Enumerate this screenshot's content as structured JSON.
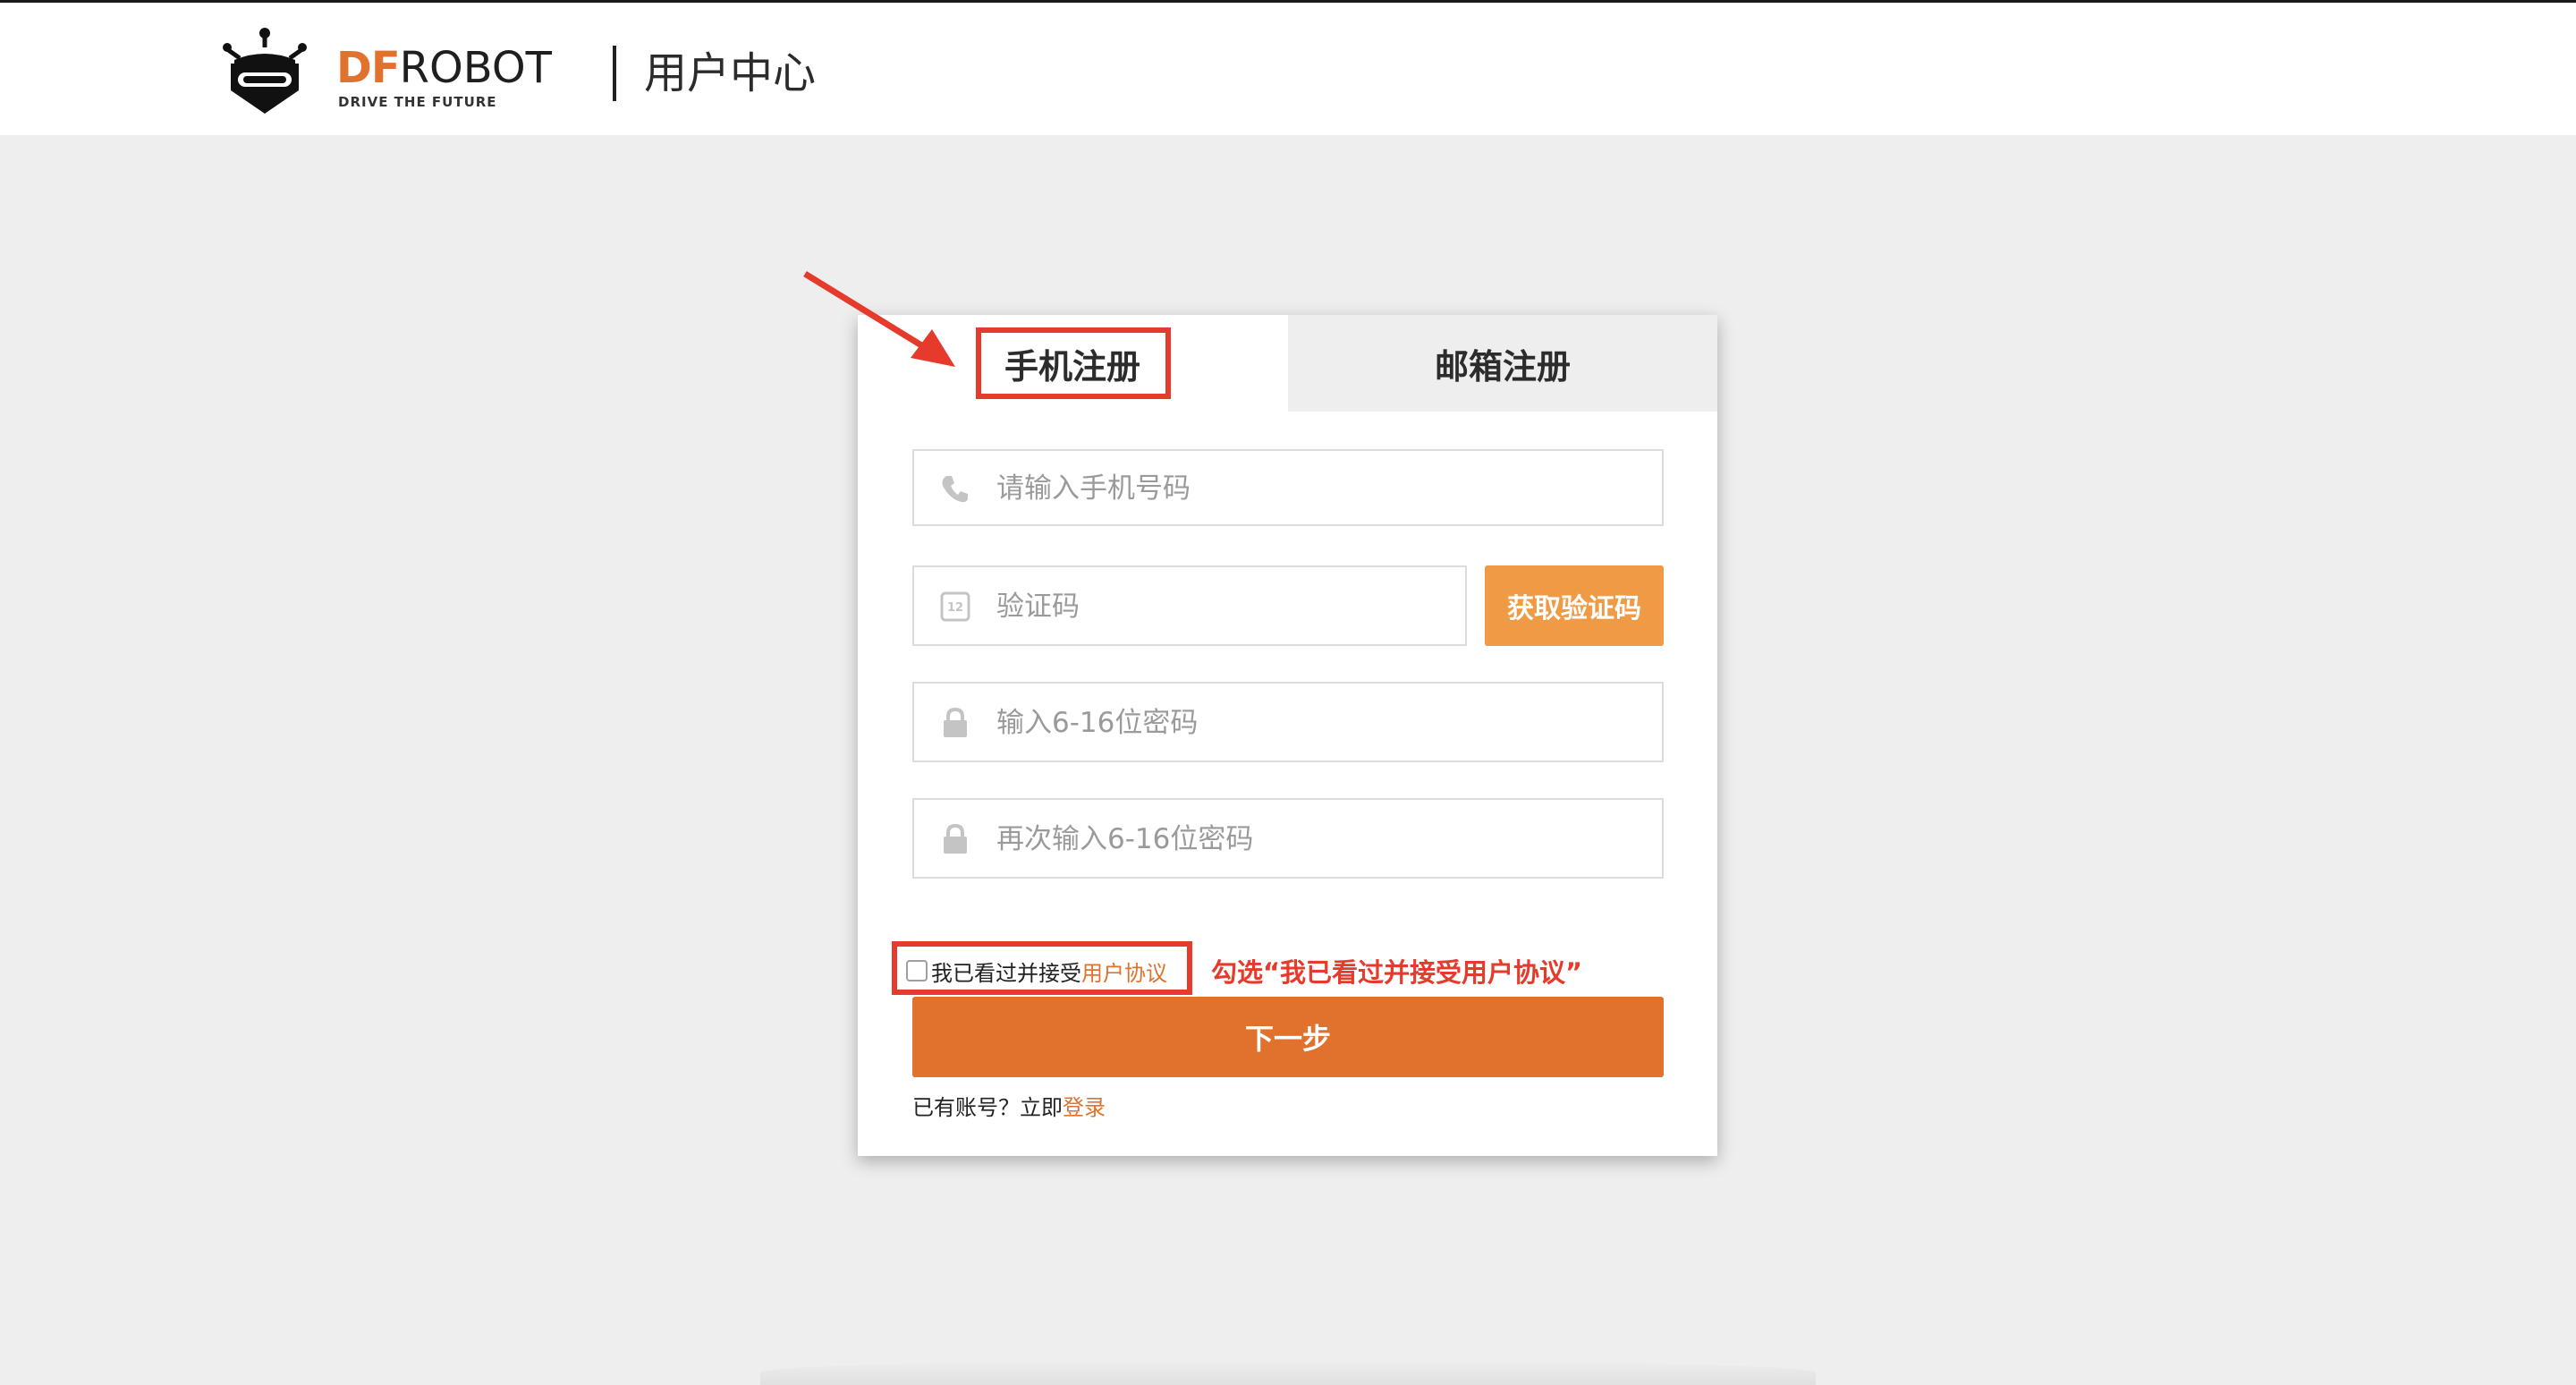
{
  "header": {
    "brand_prefix": "DF",
    "brand_suffix": "ROBOT",
    "tagline": "DRIVE THE FUTURE",
    "section_title": "用户中心"
  },
  "tabs": [
    {
      "label": "手机注册",
      "active": true
    },
    {
      "label": "邮箱注册",
      "active": false
    }
  ],
  "form": {
    "phone_placeholder": "请输入手机号码",
    "code_placeholder": "验证码",
    "get_code_label": "获取验证码",
    "password_placeholder": "输入6-16位密码",
    "password_confirm_placeholder": "再次输入6-16位密码",
    "agree_text": "我已看过并接受",
    "agree_link": "用户协议",
    "agree_checked": false,
    "next_label": "下一步",
    "have_account_text": "已有账号？立即",
    "login_link": "登录"
  },
  "annotation": {
    "note": "勾选“我已看过并接受用户协议”"
  },
  "colors": {
    "accent": "#e0722d",
    "code_button": "#ef9a44",
    "annotation_red": "#e53a2c",
    "page_bg": "#eeeeee"
  },
  "icons": {
    "logo": "robot-logo-icon",
    "phone": "phone-icon",
    "code": "verification-code-icon",
    "password": "lock-icon",
    "password_confirm": "lock-icon"
  }
}
